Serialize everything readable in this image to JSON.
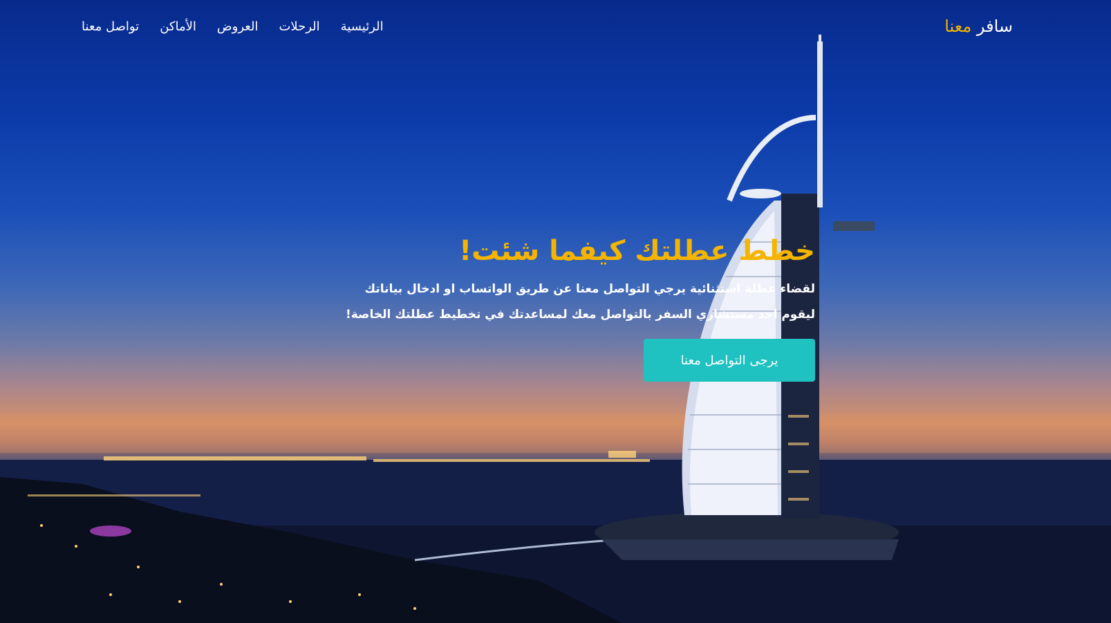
{
  "brand": {
    "name_part1": "سافر",
    "name_part2": "معنا"
  },
  "nav": {
    "items": [
      {
        "label": "الرئيسية"
      },
      {
        "label": "الرحلات"
      },
      {
        "label": "العروض"
      },
      {
        "label": "الأماكن"
      },
      {
        "label": "تواصل معنا"
      }
    ]
  },
  "hero": {
    "title": "خطط عطلتك كيفما شئت!",
    "description": "لقضاء عطلة استثنائية يرجي التواصل معنا عن طريق الواتساب او ادخال بياناتك ليقوم احد مستشاري السفر بالتواصل معك لمساعدتك في تخطيط عطلتك الخاصة!",
    "cta_label": "يرجى التواصل معنا"
  },
  "colors": {
    "accent": "#f4b400",
    "cta": "#1fc2c0",
    "text": "#ffffff"
  }
}
